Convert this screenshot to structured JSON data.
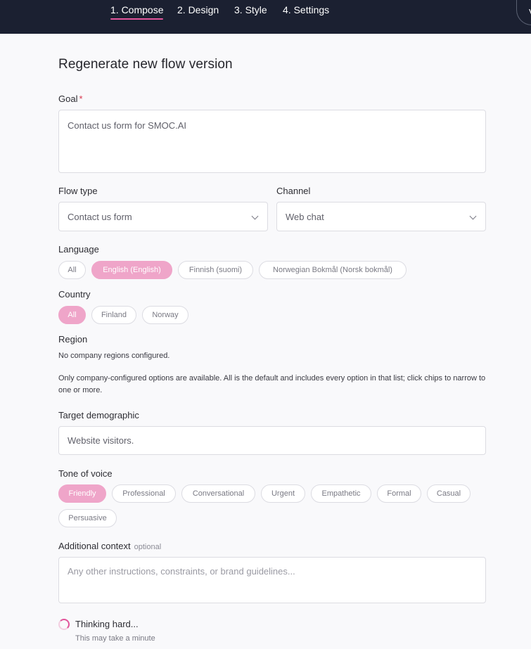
{
  "nav": {
    "steps": [
      {
        "label": "1. Compose",
        "active": true
      },
      {
        "label": "2. Design",
        "active": false
      },
      {
        "label": "3. Style",
        "active": false
      },
      {
        "label": "4. Settings",
        "active": false
      }
    ],
    "avatar_initial": "V"
  },
  "page_title": "Regenerate new flow version",
  "goal": {
    "label": "Goal",
    "required_mark": "*",
    "value": "Contact us form for SMOC.AI"
  },
  "flow_type": {
    "label": "Flow type",
    "value": "Contact us form"
  },
  "channel": {
    "label": "Channel",
    "value": "Web chat"
  },
  "language": {
    "label": "Language",
    "options": [
      "All",
      "English (English)",
      "Finnish (suomi)",
      "Norwegian Bokmål (Norsk bokmål)"
    ],
    "selected": "English (English)"
  },
  "country": {
    "label": "Country",
    "options": [
      "All",
      "Finland",
      "Norway"
    ],
    "selected": "All"
  },
  "region": {
    "label": "Region",
    "empty_text": "No company regions configured."
  },
  "help_text": "Only company-configured options are available. All is the default and includes every option in that list; click chips to narrow to one or more.",
  "target_demographic": {
    "label": "Target demographic",
    "value": "Website visitors."
  },
  "tone": {
    "label": "Tone of voice",
    "options": [
      "Friendly",
      "Professional",
      "Conversational",
      "Urgent",
      "Empathetic",
      "Formal",
      "Casual",
      "Persuasive"
    ],
    "selected": "Friendly"
  },
  "additional_context": {
    "label": "Additional context",
    "optional_label": "optional",
    "placeholder": "Any other instructions, constraints, or brand guidelines..."
  },
  "status": {
    "title": "Thinking hard...",
    "subtitle": "This may take a minute"
  },
  "colors": {
    "topbar": "#1b2031",
    "accent": "#e2559b",
    "chip_selected": "#efa5c9"
  }
}
